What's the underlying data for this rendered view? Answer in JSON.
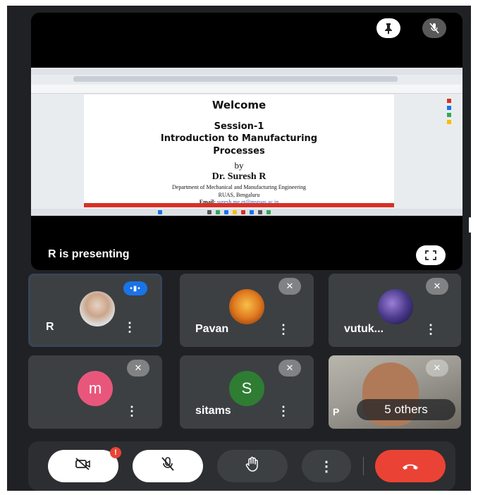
{
  "presentation": {
    "status": "R is presenting",
    "slide": {
      "welcome": "Welcome",
      "session": "Session-1",
      "title_line1": "Introduction to Manufacturing",
      "title_line2": "Processes",
      "by": "by",
      "presenter": "Dr. Suresh R",
      "department": "Department of Mechanical and Manufacturing Engineering",
      "institution": "RUAS, Bengaluru",
      "email_label": "Email:",
      "email": "suresh.me.et@msruas.ac.in"
    }
  },
  "icons": {
    "pin": "pin-icon",
    "mic_off": "mic-off-icon",
    "fullscreen": "fullscreen-icon",
    "more": "more-vert-icon",
    "speaking": "speaking-indicator-icon",
    "camera_off": "camera-off-icon",
    "raise_hand": "raise-hand-icon",
    "end_call": "end-call-icon"
  },
  "participants": [
    {
      "name": "R",
      "avatar": "photo",
      "speaking": true
    },
    {
      "name": "Pavan",
      "avatar": "photo",
      "muted": true
    },
    {
      "name": "vutuk...",
      "avatar": "photo",
      "muted": true
    },
    {
      "name": "",
      "avatar_letter": "m",
      "avatar_color": "#e8577b",
      "muted": true
    },
    {
      "name": "sitams",
      "avatar_letter": "S",
      "avatar_color": "#2e7d32",
      "muted": true
    },
    {
      "name": "P",
      "avatar": "video",
      "muted": true,
      "overlay": "5 others"
    }
  ],
  "controls": {
    "camera_badge": "!",
    "more_dots": "⋮"
  },
  "colors": {
    "background": "#202124",
    "tile": "#3c4043",
    "end_call": "#ea4335",
    "speaking": "#1a73e8"
  }
}
